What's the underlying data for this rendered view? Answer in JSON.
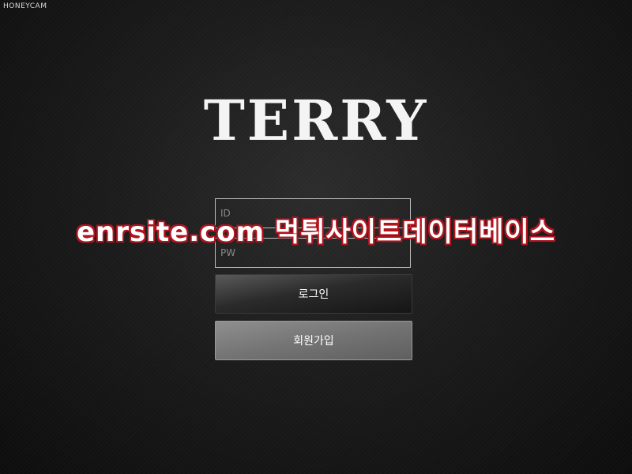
{
  "watermark_tag": "HONEYCAM",
  "logo_text": "TERRY",
  "login_form": {
    "id_placeholder": "ID",
    "id_value": "",
    "pw_placeholder": "PW",
    "pw_value": "",
    "login_label": "로그인",
    "signup_label": "회원가입"
  },
  "overlay_watermark": "enrsite.com 먹튀사이트데이터베이스",
  "colors": {
    "background": "#151515",
    "field_border": "#bdbdbd",
    "login_button": "#2b2b2b",
    "signup_button": "#747474",
    "watermark_outline": "#b0151f"
  }
}
